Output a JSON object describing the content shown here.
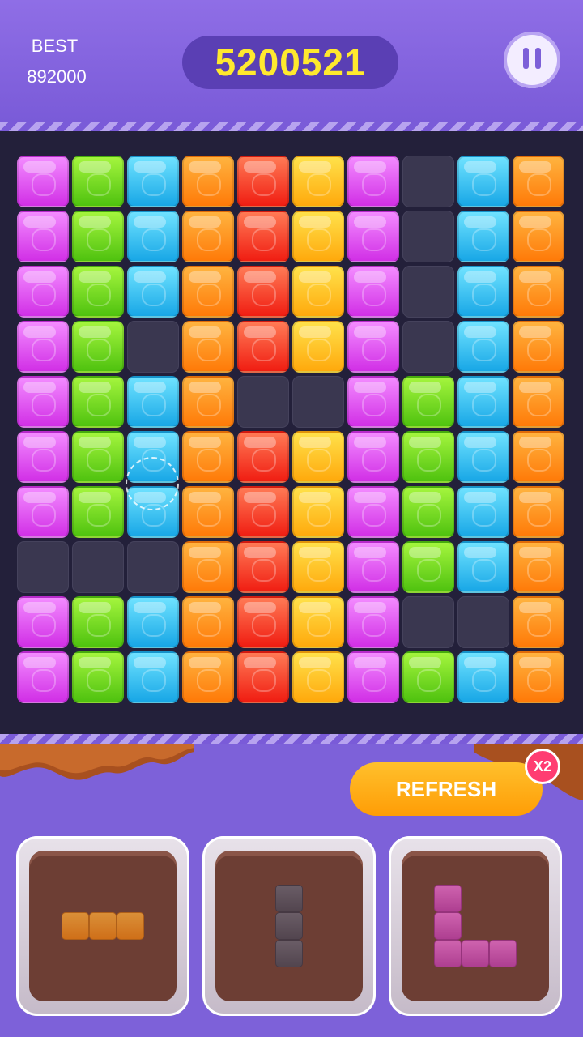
{
  "header": {
    "best_label": "BEST",
    "best_value": "892000",
    "score": "5200521",
    "pause_icon": "pause-icon"
  },
  "board": {
    "rows": 10,
    "cols": 10,
    "colors": {
      "P": "#e459f5",
      "G": "#76d927",
      "B": "#3fc4f3",
      "O": "#ff9a1f",
      "R": "#f8422a",
      "Y": "#ffc52a",
      "_": "#3a3750"
    },
    "grid": [
      "PGBORYP_BO",
      "PGBORYP_BO",
      "PGBORYP_BO",
      "PG_ORYP_BO",
      "PGBO__PGBO",
      "PGBORYPGBO",
      "PGBORYPGBO",
      "___ORYPGBO",
      "PGBORYP__O",
      "PGBORYPGBO"
    ]
  },
  "actions": {
    "refresh_label": "REFRESH",
    "multiplier_label": "X2"
  },
  "pieces": [
    {
      "name": "piece-orange-horizontal-3",
      "color": "orange",
      "cells": [
        [
          0,
          0
        ],
        [
          1,
          0
        ],
        [
          2,
          0
        ]
      ]
    },
    {
      "name": "piece-dark-vertical-3",
      "color": "dark",
      "cells": [
        [
          0,
          0
        ],
        [
          0,
          1
        ],
        [
          0,
          2
        ]
      ]
    },
    {
      "name": "piece-pink-l-shape",
      "color": "pink",
      "cells": [
        [
          0,
          0
        ],
        [
          0,
          1
        ],
        [
          0,
          2
        ],
        [
          1,
          2
        ],
        [
          2,
          2
        ]
      ]
    }
  ]
}
